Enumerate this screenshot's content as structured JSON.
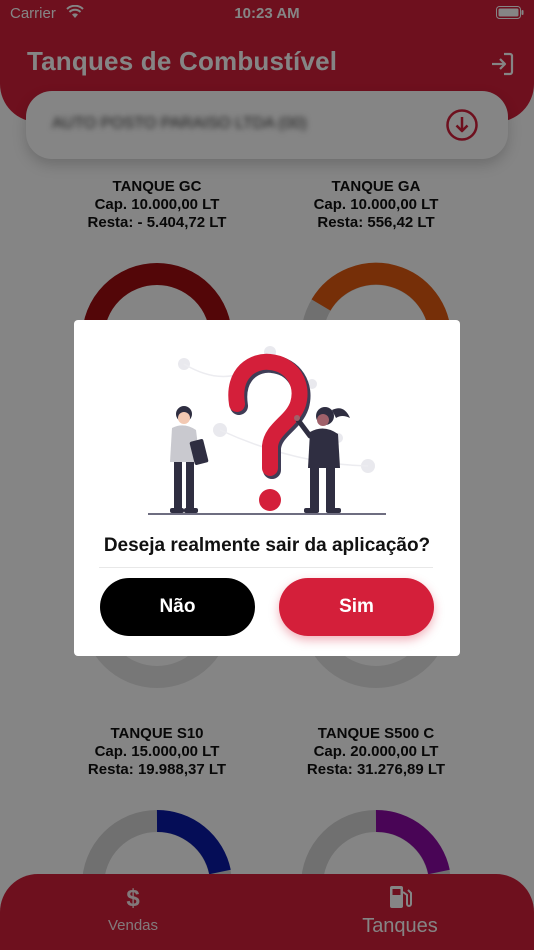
{
  "status_bar": {
    "carrier": "Carrier",
    "time": "10:23 AM"
  },
  "header": {
    "title": "Tanques de Combustível",
    "logout_icon": "logout-icon"
  },
  "selector": {
    "value": "AUTO POSTO PARAISO LTDA (00)",
    "icon": "download-circle-icon"
  },
  "tanks": [
    {
      "name": "TANQUE GC",
      "cap": "Cap.  10.000,00 LT",
      "rest": "Resta: - 5.404,72 LT",
      "color": "#a00c10"
    },
    {
      "name": "TANQUE GA",
      "cap": "Cap.  10.000,00 LT",
      "rest": "Resta:  556,42 LT",
      "color": "#e35b10"
    },
    {
      "name": "TANQUE S10",
      "cap": "Cap.  15.000,00 LT",
      "rest": "Resta:  19.988,37 LT",
      "color": "#0a1aa8"
    },
    {
      "name": "TANQUE S500 C",
      "cap": "Cap.  20.000,00 LT",
      "rest": "Resta:  31.276,89 LT",
      "color": "#8c0aa6"
    }
  ],
  "bottom_nav": {
    "items": [
      {
        "label": "Vendas",
        "icon": "dollar-icon",
        "active": false
      },
      {
        "label": "Tanques",
        "icon": "fuel-pump-icon",
        "active": true
      }
    ]
  },
  "dialog": {
    "question": "Deseja realmente sair da aplicação?",
    "no_label": "Não",
    "yes_label": "Sim"
  },
  "colors": {
    "primary": "#d41f3a",
    "overlay": "rgba(0,0,0,0.48)"
  }
}
